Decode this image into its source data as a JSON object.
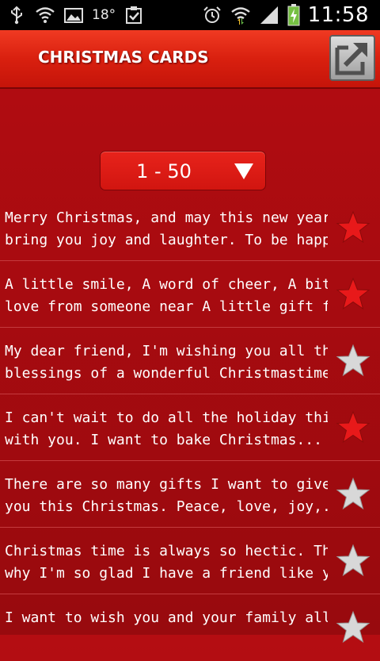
{
  "status_bar": {
    "temperature": "18°",
    "time": "11:58",
    "icons": [
      "usb-icon",
      "wifi-icon",
      "image-icon",
      "temperature-icon",
      "clipboard-check-icon",
      "alarm-icon",
      "wifi-signal-icon",
      "cell-signal-icon",
      "battery-charging-icon"
    ]
  },
  "header": {
    "title": "CHRISTMAS CARDS",
    "share_icon": "share-icon"
  },
  "range_select": {
    "value": "1 - 50",
    "arrow_icon": "triangle-down-icon"
  },
  "colors": {
    "background": "#a90b10",
    "header": "#d9200f",
    "star_favorite": "#e8191a",
    "star_normal": "#d8d8d8"
  },
  "messages": [
    {
      "line1": "Merry Christmas, and may this new year",
      "line2": "bring you joy and laughter. To be happy ...",
      "favorite": true
    },
    {
      "line1": "A little smile, A word of cheer, A bit of",
      "line2": "love from someone near A little gift fro...",
      "favorite": true
    },
    {
      "line1": "My dear friend, I'm wishing you all the",
      "line2": "blessings of a wonderful Christmastime...",
      "favorite": false
    },
    {
      "line1": "I can't wait to do all the holiday things",
      "line2": "with you. I want to bake Christmas...",
      "favorite": true
    },
    {
      "line1": "There are so many gifts I want to give to",
      "line2": "you this Christmas. Peace, love, joy,...",
      "favorite": false
    },
    {
      "line1": "Christmas time is always so hectic. That's",
      "line2": "why I'm so glad I have a friend like you ...",
      "favorite": false
    },
    {
      "line1": "I want to wish you and your family all the",
      "line2": "",
      "favorite": false
    }
  ]
}
